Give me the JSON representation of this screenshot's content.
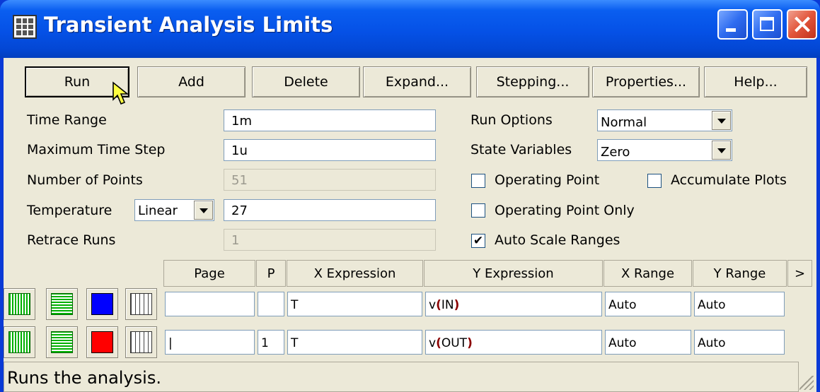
{
  "window": {
    "title": "Transient Analysis Limits",
    "icon": "table-grid-icon"
  },
  "toolbar": {
    "run": "Run",
    "add": "Add",
    "delete": "Delete",
    "expand": "Expand...",
    "stepping": "Stepping...",
    "properties": "Properties...",
    "help": "Help..."
  },
  "limits": {
    "time_range_label": "Time Range",
    "time_range_value": "1m",
    "max_step_label": "Maximum Time Step",
    "max_step_value": "1u",
    "num_points_label": "Number of Points",
    "num_points_value": "51",
    "temperature_label": "Temperature",
    "temperature_mode": "Linear",
    "temperature_value": "27",
    "retrace_label": "Retrace Runs",
    "retrace_value": "1"
  },
  "options": {
    "run_options_label": "Run Options",
    "run_options_value": "Normal",
    "state_vars_label": "State Variables",
    "state_vars_value": "Zero",
    "operating_point": "Operating Point",
    "operating_point_checked": false,
    "accumulate_plots": "Accumulate Plots",
    "accumulate_plots_checked": false,
    "operating_point_only": "Operating Point Only",
    "operating_point_only_checked": false,
    "auto_scale": "Auto Scale Ranges",
    "auto_scale_checked": true,
    "checkmark": "✔"
  },
  "table": {
    "headers": [
      "Page",
      "P",
      "X Expression",
      "Y Expression",
      "X Range",
      "Y Range",
      ">"
    ],
    "rows": [
      {
        "color": "#0000ff",
        "page": "",
        "p": "",
        "x_expr": "T",
        "y_fn": "v",
        "y_open": "(",
        "y_arg": "IN",
        "y_close": ")",
        "x_range": "Auto",
        "y_range": "Auto"
      },
      {
        "color": "#ff0000",
        "page": "|",
        "p": "1",
        "x_expr": "T",
        "y_fn": "v",
        "y_open": "(",
        "y_arg": "OUT",
        "y_close": ")",
        "x_range": "Auto",
        "y_range": "Auto"
      }
    ]
  },
  "status": {
    "text": "Runs the analysis."
  }
}
